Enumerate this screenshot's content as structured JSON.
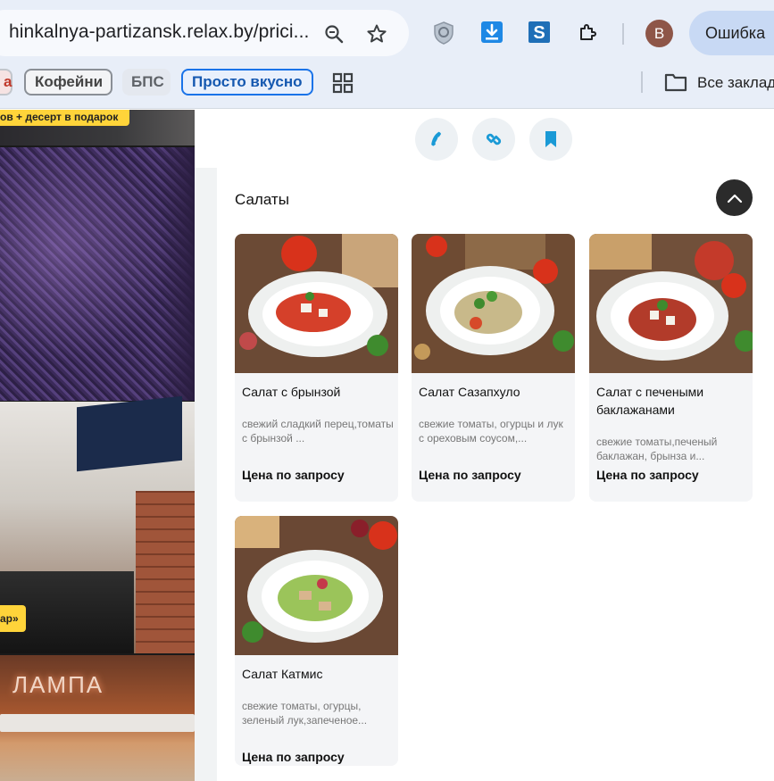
{
  "browser": {
    "url": "hinkalnya-partizansk.relax.by/prici...",
    "avatar_letter": "В",
    "error_label": "Ошибка",
    "bookmarks": {
      "partial": "а",
      "coffee": "Кофейни",
      "bps": "БПС",
      "tasty": "Просто вкусно",
      "all": "Все заклад"
    }
  },
  "left_column": {
    "promo_top": "ов + десерт в подарок",
    "promo_side": "ар»",
    "sign_text": "ЛАМПА"
  },
  "section": {
    "title": "Салаты"
  },
  "dishes": [
    {
      "name": "Салат с брынзой",
      "description": "свежий сладкий перец,томаты с брынзой ...",
      "price": "Цена по запросу"
    },
    {
      "name": "Салат Сазапхуло",
      "description": "свежие томаты, огурцы и лук с ореховым соусом,...",
      "price": "Цена по запросу"
    },
    {
      "name": "Салат с печеными баклажанами",
      "description": "свежие томаты,печеный баклажан, брынза и...",
      "price": "Цена по запросу"
    },
    {
      "name": "Салат Катмис",
      "description": "свежие томаты, огурцы, зеленый лук,запеченое...",
      "price": "Цена по запросу"
    }
  ],
  "colors": {
    "browser_bar": "#e8eef8",
    "accent_blue": "#1a73e8",
    "action_icon": "#1a9ad6",
    "promo_yellow": "#ffd43a"
  }
}
